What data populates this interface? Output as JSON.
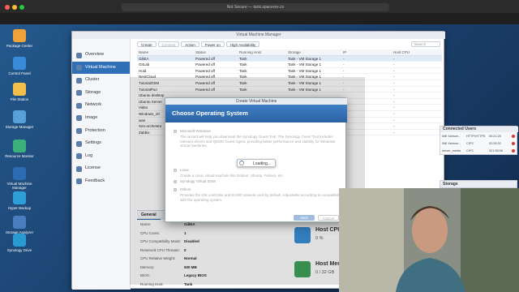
{
  "browser": {
    "url": "Not Secure — tank.spacerex.co"
  },
  "desktop": {
    "icons": [
      {
        "label": "Package Center",
        "icon": "package-icon",
        "color": "#f0a13a"
      },
      {
        "label": "Control Panel",
        "icon": "control-panel-icon",
        "color": "#3a8bd8"
      },
      {
        "label": "File Station",
        "icon": "folder-icon",
        "color": "#f2c04a"
      },
      {
        "label": "Storage Manager",
        "icon": "storage-icon",
        "color": "#5aa0d8"
      },
      {
        "label": "Resource Monitor",
        "icon": "monitor-icon",
        "color": "#3cb07a"
      },
      {
        "label": "Virtual Machine Manager",
        "icon": "vm-icon",
        "color": "#2d6bb3"
      },
      {
        "label": "Hyper Backup",
        "icon": "backup-icon",
        "color": "#2e9fd9"
      },
      {
        "label": "Storage Analyzer",
        "icon": "analyzer-icon",
        "color": "#4a7dc0"
      },
      {
        "label": "Synology Drive",
        "icon": "drive-icon",
        "color": "#2a9ad1"
      }
    ]
  },
  "vmm": {
    "title": "Virtual Machine Manager",
    "sidebar": [
      "Overview",
      "Virtual Machine",
      "Cluster",
      "Storage",
      "Network",
      "Image",
      "Protection",
      "Settings",
      "Log",
      "License",
      "Feedback"
    ],
    "active_index": 1,
    "toolbar": {
      "create": "Create",
      "connect": "Connect",
      "action": "Action",
      "power_on": "Power on",
      "high_availability": "High Availability",
      "search_placeholder": "Search"
    },
    "columns": [
      "Name",
      "Status",
      "Running Host",
      "Storage",
      "IP",
      "Host CPU"
    ],
    "rows": [
      {
        "name": "GiliEA",
        "status": "Powered off",
        "host": "Tank",
        "storage": "Tank - VM Storage 1",
        "ip": "-",
        "cpu": "-"
      },
      {
        "name": "GitLab",
        "status": "Powered off",
        "host": "Tank",
        "storage": "Tank - VM Storage 1",
        "ip": "-",
        "cpu": "-"
      },
      {
        "name": "Hold",
        "status": "Powered off",
        "host": "Tank",
        "storage": "Tank - VM Storage 1",
        "ip": "-",
        "cpu": "-"
      },
      {
        "name": "NextCloud",
        "status": "Powered off",
        "host": "Tank",
        "storage": "Tank - VM Storage 1",
        "ip": "-",
        "cpu": "-"
      },
      {
        "name": "TutorialOSM",
        "status": "Powered off",
        "host": "Tank",
        "storage": "Tank - VM Storage 1",
        "ip": "-",
        "cpu": "-"
      },
      {
        "name": "TutorialPun",
        "status": "Powered off",
        "host": "Tank",
        "storage": "Tank - VM Storage 1",
        "ip": "-",
        "cpu": "-"
      },
      {
        "name": "Ubuntu desktop",
        "status": "",
        "host": "",
        "storage": "",
        "ip": "",
        "cpu": "-"
      },
      {
        "name": "Ubuntu Server",
        "status": "",
        "host": "",
        "storage": "",
        "ip": "",
        "cpu": "-"
      },
      {
        "name": "Video",
        "status": "",
        "host": "",
        "storage": "",
        "ip": "",
        "cpu": "-"
      },
      {
        "name": "Windows_10",
        "status": "",
        "host": "",
        "storage": "",
        "ip": "",
        "cpu": "-"
      },
      {
        "name": "wan",
        "status": "",
        "host": "",
        "storage": "",
        "ip": "",
        "cpu": "-"
      },
      {
        "name": "Xen-orchestra",
        "status": "",
        "host": "",
        "storage": "",
        "ip": "",
        "cpu": "-"
      },
      {
        "name": "Zabbix",
        "status": "",
        "host": "",
        "storage": "",
        "ip": "",
        "cpu": "-"
      }
    ],
    "detail": {
      "tabs": [
        "General",
        "Virtual Disk"
      ],
      "props": [
        {
          "label": "Name:",
          "value": "GiliEA"
        },
        {
          "label": "CPU Cores:",
          "value": "1"
        },
        {
          "label": "CPU Compatibility Mode:",
          "value": "Disabled"
        },
        {
          "label": "Reserved CPU Threads:",
          "value": "0"
        },
        {
          "label": "CPU Relative Weight:",
          "value": "Normal"
        },
        {
          "label": "Memory:",
          "value": "500 MB"
        },
        {
          "label": "BIOS:",
          "value": "Legacy BIOS"
        },
        {
          "label": "Running Host:",
          "value": "Tank"
        }
      ],
      "host_cpu": {
        "label": "Host CPU",
        "value": "0 %"
      },
      "host_mem": {
        "label": "Host Memory",
        "value": "0 / 32 GB"
      }
    }
  },
  "modal": {
    "window_title": "Create Virtual Machine",
    "heading": "Choose Operating System",
    "options": [
      {
        "label": "Microsoft Windows",
        "desc": "The wizard will help you download the Synology Guest Tool. The Synology Guest Tool includes relevant drivers and QEMU Guest Agent, providing better performance and stability for Windows virtual machines."
      },
      {
        "label": "Linux",
        "desc": "Create a Linux virtual machine like Debian, Ubuntu, Fedora, etc."
      },
      {
        "label": "Synology Virtual DSM",
        "desc": ""
      },
      {
        "label": "Others",
        "desc": "Provides the IDE controller and E1000 network card by default. Adjustable according to compatibility with the operating system."
      }
    ],
    "loading": "Loading...",
    "next": "Next",
    "cancel": "Cancel",
    "accent": "#2f6fb5"
  },
  "connected_users": {
    "title": "Connected Users",
    "rows": [
      {
        "user": "Will Yarbom...",
        "type": "HTTP/HTTPS",
        "time": "00:21:26"
      },
      {
        "user": "Will Yarbom...",
        "type": "CIFS",
        "time": "02:35:32"
      },
      {
        "user": "server_media",
        "type": "CIFS",
        "time": "321:35:56"
      }
    ]
  },
  "storage_widget": {
    "title": "Storage"
  }
}
